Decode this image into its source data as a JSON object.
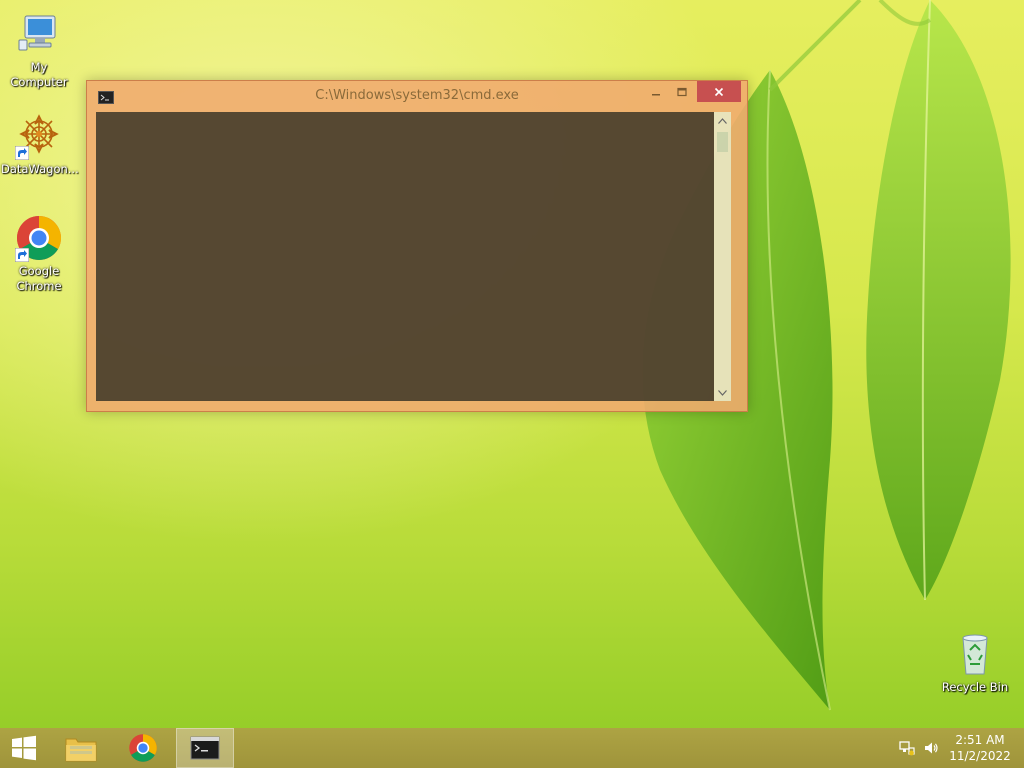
{
  "desktop": {
    "icons": [
      {
        "label": "My Computer",
        "icon": "computer-icon"
      },
      {
        "label": "DataWagon...",
        "icon": "datawagon-icon"
      },
      {
        "label": "Google Chrome",
        "icon": "chrome-icon"
      },
      {
        "label": "Recycle Bin",
        "icon": "recycle-bin-icon"
      }
    ]
  },
  "window": {
    "title": "C:\\Windows\\system32\\cmd.exe",
    "icon": "cmd-icon",
    "controls": {
      "minimize": "minimize-icon",
      "maximize": "maximize-icon",
      "close": "close-icon"
    },
    "console_text": ""
  },
  "taskbar": {
    "items": [
      {
        "icon": "windows-start-icon"
      },
      {
        "icon": "file-explorer-icon"
      },
      {
        "icon": "chrome-icon"
      },
      {
        "icon": "cmd-icon",
        "active": true
      }
    ],
    "tray": {
      "network_icon": "network-icon",
      "volume_icon": "volume-icon",
      "time": "2:51 AM",
      "date": "11/2/2022"
    }
  },
  "colors": {
    "window_frame": "#f0aa6e",
    "close_button": "#c75050",
    "taskbar": "#a8963f"
  }
}
